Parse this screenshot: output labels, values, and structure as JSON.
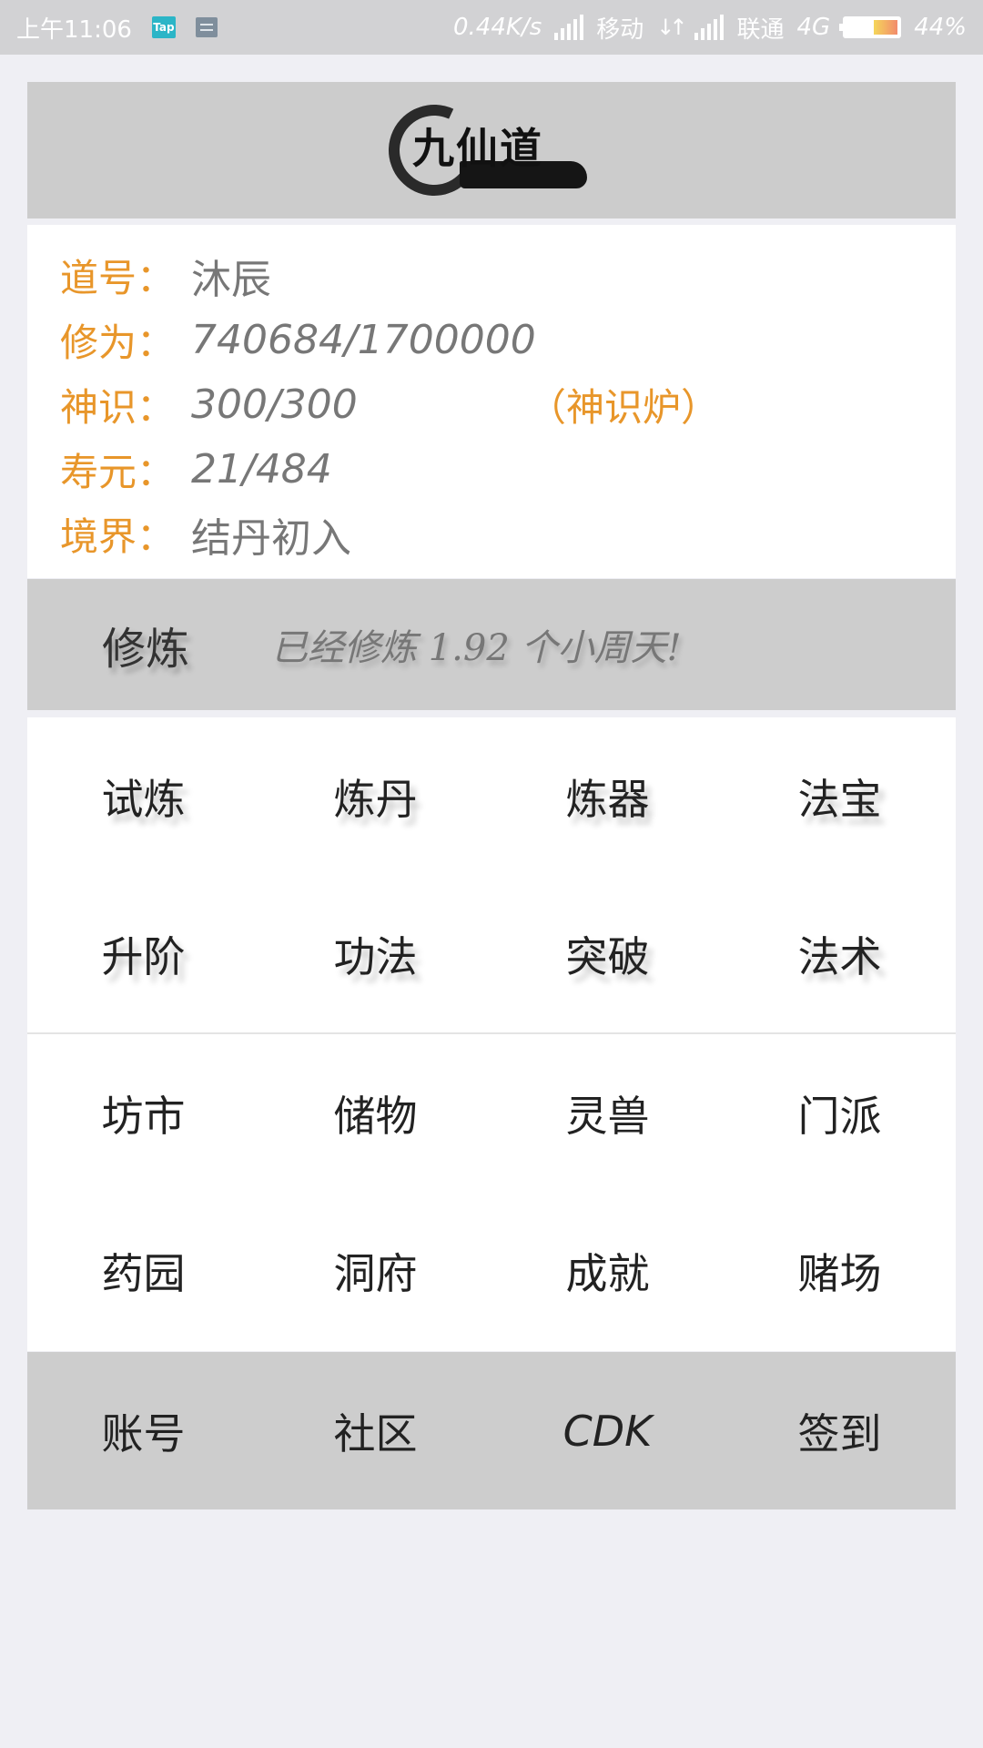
{
  "status_bar": {
    "time": "上午11:06",
    "tap_badge": "Tap",
    "net_speed": "0.44K/s",
    "carrier1": "移动",
    "carrier2": "联通",
    "network": "4G",
    "battery": "44%",
    "battery_level_percent": 44
  },
  "header": {
    "logo_text": "九仙道"
  },
  "profile": {
    "rows": [
      {
        "label": "道号：",
        "value": "沐辰"
      },
      {
        "label": "修为：",
        "value": "740684/1700000"
      },
      {
        "label": "神识：",
        "value": "300/300",
        "link": "（神识炉）"
      },
      {
        "label": "寿元：",
        "value": "21/484"
      },
      {
        "label": "境界：",
        "value": "结丹初入"
      }
    ]
  },
  "cultivation": {
    "label": "修炼",
    "status": "已经修炼 1.92 个小周天!"
  },
  "menu_group1": {
    "row1": [
      "试炼",
      "炼丹",
      "炼器",
      "法宝"
    ],
    "row2": [
      "升阶",
      "功法",
      "突破",
      "法术"
    ]
  },
  "menu_group2": {
    "row1": [
      "坊市",
      "储物",
      "灵兽",
      "门派"
    ],
    "row2": [
      "药园",
      "洞府",
      "成就",
      "赌场"
    ]
  },
  "bottom_bar": {
    "items": [
      "账号",
      "社区",
      "CDK",
      "签到"
    ]
  }
}
